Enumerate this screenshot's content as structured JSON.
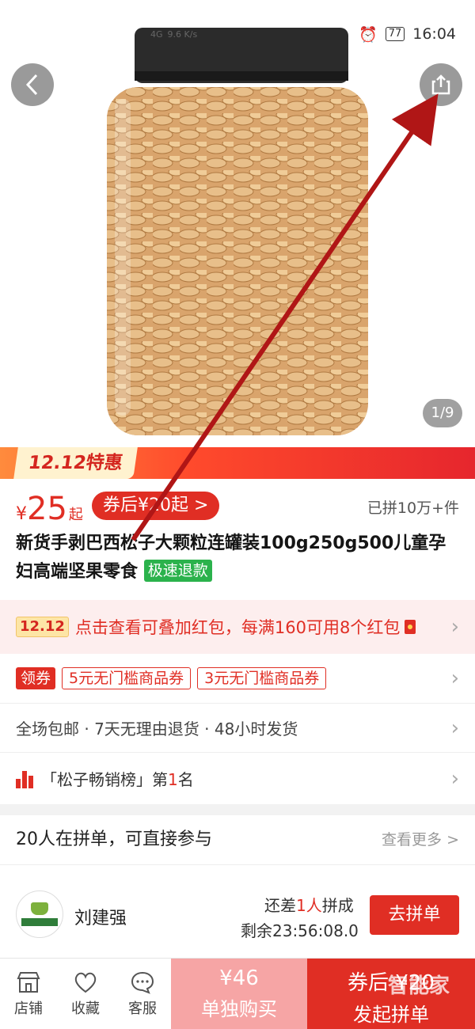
{
  "status_bar": {
    "network": "4G",
    "speed": "9.6 K/s",
    "battery": "77",
    "time": "16:04"
  },
  "gallery": {
    "page_indicator": "1/9"
  },
  "promo_banner": {
    "tag": "12.12特惠"
  },
  "price": {
    "currency": "¥",
    "value": "25",
    "suffix": "起",
    "coupon_price": "券后¥20起 >",
    "sold": "已拼10万+件"
  },
  "product": {
    "title": "新货手剥巴西松子大颗粒连罐装100g250g500儿童孕妇高端坚果零食",
    "badge": "极速退款"
  },
  "red_packet": {
    "tag": "12.12",
    "text": "点击查看可叠加红包，每满160可用8个红包"
  },
  "coupons": {
    "label": "领券",
    "items": [
      "5元无门槛商品券",
      "3元无门槛商品券"
    ]
  },
  "services": {
    "text": "全场包邮 · 7天无理由退货 · 48小时发货"
  },
  "ranking": {
    "prefix": "「松子畅销榜」第",
    "rank": "1",
    "suffix": "名"
  },
  "group_buy": {
    "heading": "20人在拼单，可直接参与",
    "more": "查看更多 >",
    "member": {
      "name": "刘建强",
      "need_prefix": "还差",
      "need_count": "1人",
      "need_suffix": "拼成",
      "remain": "剩余23:56:08.0",
      "join_label": "去拼单"
    }
  },
  "bottom_bar": {
    "tabs": [
      {
        "label": "店铺",
        "icon": "shop-icon"
      },
      {
        "label": "收藏",
        "icon": "heart-icon"
      },
      {
        "label": "客服",
        "icon": "chat-icon"
      }
    ],
    "solo": {
      "price": "¥46",
      "label": "单独购买"
    },
    "group": {
      "price": "券后 ¥20",
      "label": "发起拼单"
    }
  },
  "watermark": "智能家",
  "colors": {
    "accent": "#e02e24",
    "refund_badge": "#2bb24c",
    "solo_button": "#f6a5a5"
  }
}
